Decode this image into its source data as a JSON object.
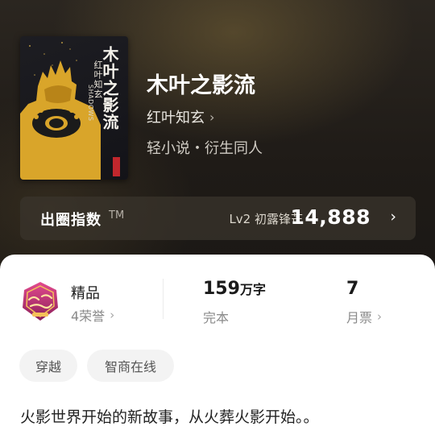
{
  "book": {
    "cover_title": "木叶之影流",
    "cover_author": "红叶知玄",
    "cover_english": "SHADOWS",
    "title": "木叶之影流",
    "author": "红叶知玄",
    "genre": "轻小说・衍生同人"
  },
  "index": {
    "label": "出圈指数",
    "trademark": "TM",
    "level": "Lv2 初露锋芒",
    "value": "14,888"
  },
  "stats": {
    "quality": {
      "label": "精品",
      "sub": "4荣誉"
    },
    "words": {
      "value": "159",
      "unit": "万字",
      "sub": "完本"
    },
    "tickets": {
      "value": "7",
      "sub": "月票"
    }
  },
  "tags": [
    "穿越",
    "智商在线"
  ],
  "description": "火影世界开始的新故事，从火葬火影开始。。",
  "colors": {
    "card_bg": "#ffffff",
    "hero_bg": "#1f1b17",
    "cover_gold": "#d9a52a",
    "badge_pink": "#c1307a"
  }
}
